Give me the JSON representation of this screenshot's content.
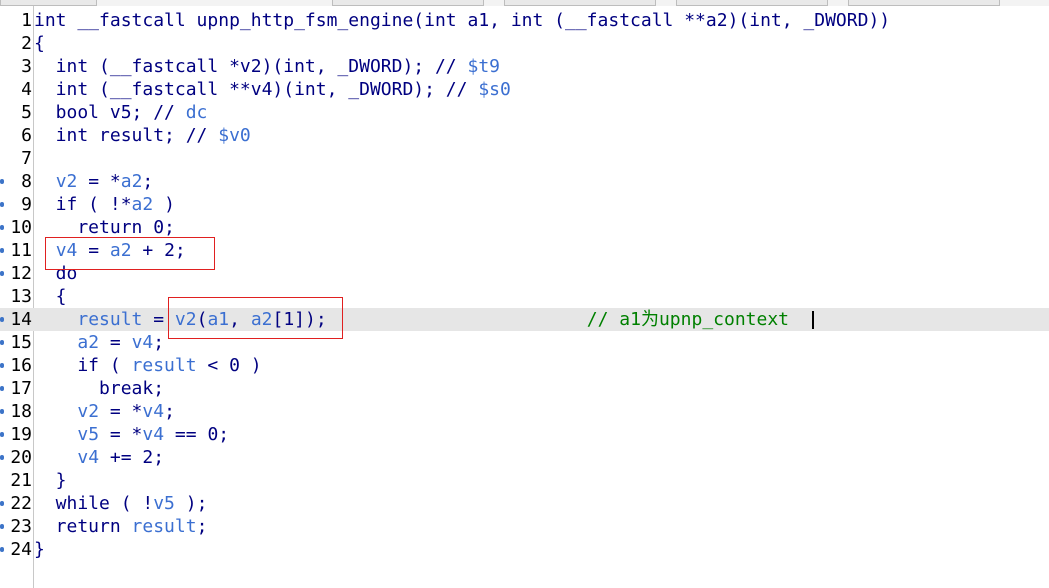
{
  "editor": {
    "tabs": [
      {
        "label": ""
      },
      {
        "label": ""
      },
      {
        "label": ""
      },
      {
        "label": ""
      },
      {
        "label": ""
      }
    ],
    "lines": [
      {
        "n": "1",
        "bp": false,
        "tokens": [
          {
            "t": "int __fastcall upnp_http_fsm_engine(int a1, int (__fastcall **a2)(int, _DWORD))",
            "c": "n"
          }
        ]
      },
      {
        "n": "2",
        "bp": false,
        "tokens": [
          {
            "t": "{",
            "c": "n"
          }
        ]
      },
      {
        "n": "3",
        "bp": false,
        "tokens": [
          {
            "t": "  int (__fastcall *v2)(int, _DWORD); // ",
            "c": "n"
          },
          {
            "t": "$t9",
            "c": "v"
          }
        ]
      },
      {
        "n": "4",
        "bp": false,
        "tokens": [
          {
            "t": "  int (__fastcall **v4)(int, _DWORD); // ",
            "c": "n"
          },
          {
            "t": "$s0",
            "c": "v"
          }
        ]
      },
      {
        "n": "5",
        "bp": false,
        "tokens": [
          {
            "t": "  bool v5; // ",
            "c": "n"
          },
          {
            "t": "dc",
            "c": "v"
          }
        ]
      },
      {
        "n": "6",
        "bp": false,
        "tokens": [
          {
            "t": "  int result; // ",
            "c": "n"
          },
          {
            "t": "$v0",
            "c": "v"
          }
        ]
      },
      {
        "n": "7",
        "bp": false,
        "tokens": [
          {
            "t": "",
            "c": "n"
          }
        ]
      },
      {
        "n": "8",
        "bp": true,
        "tokens": [
          {
            "t": "  ",
            "c": "n"
          },
          {
            "t": "v2",
            "c": "v"
          },
          {
            "t": " = *",
            "c": "n"
          },
          {
            "t": "a2",
            "c": "v"
          },
          {
            "t": ";",
            "c": "n"
          }
        ]
      },
      {
        "n": "9",
        "bp": true,
        "tokens": [
          {
            "t": "  if ( !*",
            "c": "n"
          },
          {
            "t": "a2",
            "c": "v"
          },
          {
            "t": " )",
            "c": "n"
          }
        ]
      },
      {
        "n": "10",
        "bp": true,
        "tokens": [
          {
            "t": "    return 0;",
            "c": "n"
          }
        ]
      },
      {
        "n": "11",
        "bp": true,
        "tokens": [
          {
            "t": "  ",
            "c": "n"
          },
          {
            "t": "v4",
            "c": "v"
          },
          {
            "t": " = ",
            "c": "n"
          },
          {
            "t": "a2",
            "c": "v"
          },
          {
            "t": " + 2;",
            "c": "n"
          }
        ]
      },
      {
        "n": "12",
        "bp": true,
        "tokens": [
          {
            "t": "  do",
            "c": "n"
          }
        ]
      },
      {
        "n": "13",
        "bp": false,
        "tokens": [
          {
            "t": "  {",
            "c": "n"
          }
        ]
      },
      {
        "n": "14",
        "bp": true,
        "current": true,
        "tokens": [
          {
            "t": "    ",
            "c": "n"
          },
          {
            "t": "result",
            "c": "v"
          },
          {
            "t": " = ",
            "c": "n"
          },
          {
            "t": "v2",
            "c": "v"
          },
          {
            "t": "(",
            "c": "n"
          },
          {
            "t": "a1",
            "c": "v"
          },
          {
            "t": ", ",
            "c": "n"
          },
          {
            "t": "a2",
            "c": "v"
          },
          {
            "t": "[1]);                        ",
            "c": "n"
          },
          {
            "t": "// a1为upnp_context",
            "c": "cm"
          }
        ]
      },
      {
        "n": "15",
        "bp": true,
        "tokens": [
          {
            "t": "    ",
            "c": "n"
          },
          {
            "t": "a2",
            "c": "v"
          },
          {
            "t": " = ",
            "c": "n"
          },
          {
            "t": "v4",
            "c": "v"
          },
          {
            "t": ";",
            "c": "n"
          }
        ]
      },
      {
        "n": "16",
        "bp": true,
        "tokens": [
          {
            "t": "    if ( ",
            "c": "n"
          },
          {
            "t": "result",
            "c": "v"
          },
          {
            "t": " < 0 )",
            "c": "n"
          }
        ]
      },
      {
        "n": "17",
        "bp": true,
        "tokens": [
          {
            "t": "      break;",
            "c": "n"
          }
        ]
      },
      {
        "n": "18",
        "bp": true,
        "tokens": [
          {
            "t": "    ",
            "c": "n"
          },
          {
            "t": "v2",
            "c": "v"
          },
          {
            "t": " = *",
            "c": "n"
          },
          {
            "t": "v4",
            "c": "v"
          },
          {
            "t": ";",
            "c": "n"
          }
        ]
      },
      {
        "n": "19",
        "bp": true,
        "tokens": [
          {
            "t": "    ",
            "c": "n"
          },
          {
            "t": "v5",
            "c": "v"
          },
          {
            "t": " = *",
            "c": "n"
          },
          {
            "t": "v4",
            "c": "v"
          },
          {
            "t": " == 0;",
            "c": "n"
          }
        ]
      },
      {
        "n": "20",
        "bp": true,
        "tokens": [
          {
            "t": "    ",
            "c": "n"
          },
          {
            "t": "v4",
            "c": "v"
          },
          {
            "t": " += 2;",
            "c": "n"
          }
        ]
      },
      {
        "n": "21",
        "bp": false,
        "tokens": [
          {
            "t": "  }",
            "c": "n"
          }
        ]
      },
      {
        "n": "22",
        "bp": true,
        "tokens": [
          {
            "t": "  while ( !",
            "c": "n"
          },
          {
            "t": "v5",
            "c": "v"
          },
          {
            "t": " );",
            "c": "n"
          }
        ]
      },
      {
        "n": "23",
        "bp": true,
        "tokens": [
          {
            "t": "  return ",
            "c": "n"
          },
          {
            "t": "result",
            "c": "v"
          },
          {
            "t": ";",
            "c": "n"
          }
        ]
      },
      {
        "n": "24",
        "bp": true,
        "tokens": [
          {
            "t": "}",
            "c": "n"
          }
        ]
      }
    ]
  },
  "colors": {
    "code_text": "#000080",
    "variable": "#3b6fd1",
    "comment": "#008000",
    "line_number": "#000000",
    "current_line_bg": "#e6e6e6",
    "highlight_box": "#e02020",
    "marker": "#3d74c8"
  }
}
